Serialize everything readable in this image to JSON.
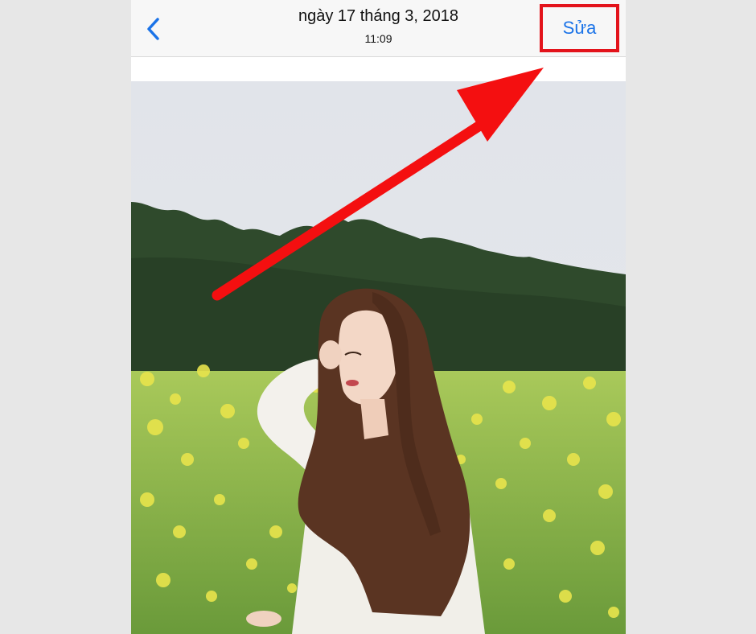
{
  "navbar": {
    "back_icon": "chevron-left-icon",
    "date": "ngày 17 tháng 3, 2018",
    "time": "11:09",
    "edit_label": "Sửa"
  },
  "colors": {
    "accent": "#1a73e8",
    "highlight": "#e3131b",
    "sky": "#e4e7ec",
    "trees": "#2f4a2c",
    "field": "#8db34a",
    "flowers": "#e5e34f",
    "hair": "#5a3422",
    "shirt": "#f1efe9"
  },
  "photo": {
    "subject_icons": [
      "sky",
      "tree-line",
      "flower-field",
      "woman-portrait"
    ]
  }
}
